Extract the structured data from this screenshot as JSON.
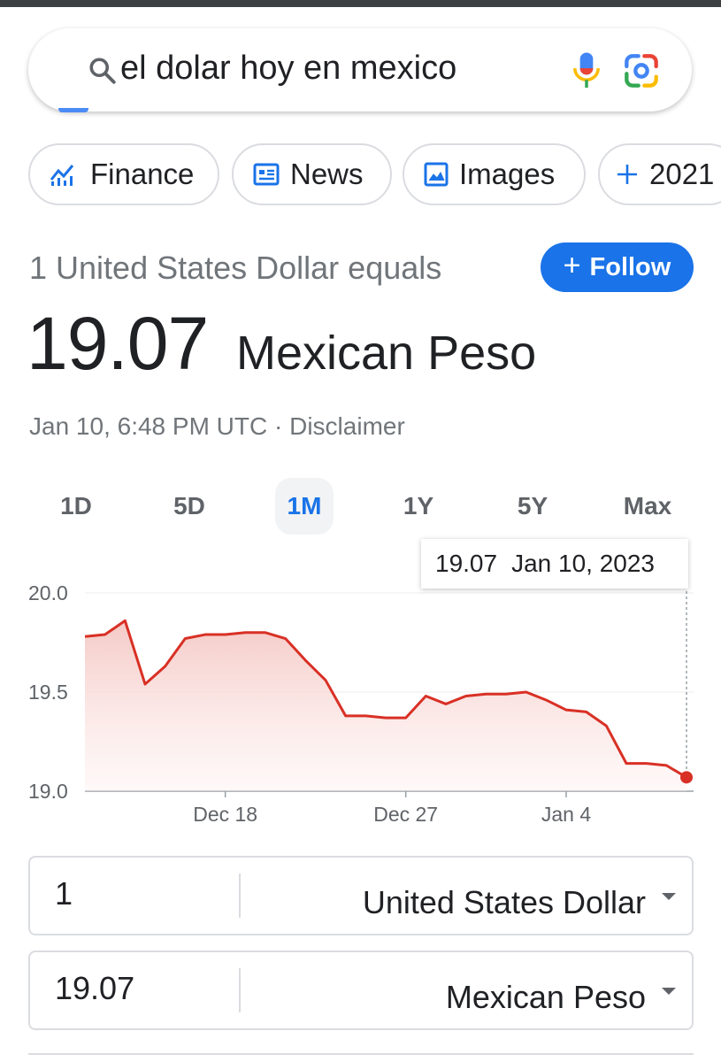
{
  "search": {
    "query": "el dolar hoy en mexico"
  },
  "chips": [
    {
      "label": "Finance",
      "icon": "finance-chart-icon"
    },
    {
      "label": "News",
      "icon": "news-icon"
    },
    {
      "label": "Images",
      "icon": "image-icon"
    },
    {
      "label": "2021",
      "icon": "plus-icon"
    }
  ],
  "rate": {
    "equals_text": "1 United States Dollar equals",
    "value": "19.07",
    "currency": "Mexican Peso",
    "timestamp": "Jan 10, 6:48 PM UTC · Disclaimer",
    "follow_label": "Follow"
  },
  "ranges": [
    "1D",
    "5D",
    "1M",
    "1Y",
    "5Y",
    "Max"
  ],
  "active_range": "1M",
  "tooltip": {
    "value": "19.07",
    "date": "Jan 10, 2023"
  },
  "chart_data": {
    "type": "area",
    "ylim": [
      19.0,
      20.0
    ],
    "yticks": [
      "20.0",
      "19.5",
      "19.0"
    ],
    "xticks": [
      "Dec 18",
      "Dec 27",
      "Jan 4"
    ],
    "x": [
      "Dec 11",
      "Dec 12",
      "Dec 13",
      "Dec 14",
      "Dec 15",
      "Dec 16",
      "Dec 17",
      "Dec 18",
      "Dec 19",
      "Dec 20",
      "Dec 21",
      "Dec 22",
      "Dec 23",
      "Dec 24",
      "Dec 25",
      "Dec 26",
      "Dec 27",
      "Dec 28",
      "Dec 29",
      "Dec 30",
      "Dec 31",
      "Jan 1",
      "Jan 2",
      "Jan 3",
      "Jan 4",
      "Jan 5",
      "Jan 6",
      "Jan 7",
      "Jan 8",
      "Jan 9",
      "Jan 10"
    ],
    "values": [
      19.78,
      19.79,
      19.86,
      19.54,
      19.63,
      19.77,
      19.79,
      19.79,
      19.8,
      19.8,
      19.77,
      19.66,
      19.56,
      19.38,
      19.38,
      19.37,
      19.37,
      19.48,
      19.44,
      19.48,
      19.49,
      19.49,
      19.5,
      19.46,
      19.41,
      19.4,
      19.33,
      19.14,
      19.14,
      19.13,
      19.07
    ],
    "line_color": "#d93025",
    "fill_color": "#f6d0cd"
  },
  "converter": {
    "from_amount": "1",
    "from_currency": "United States Dollar",
    "to_amount": "19.07",
    "to_currency": "Mexican Peso"
  }
}
